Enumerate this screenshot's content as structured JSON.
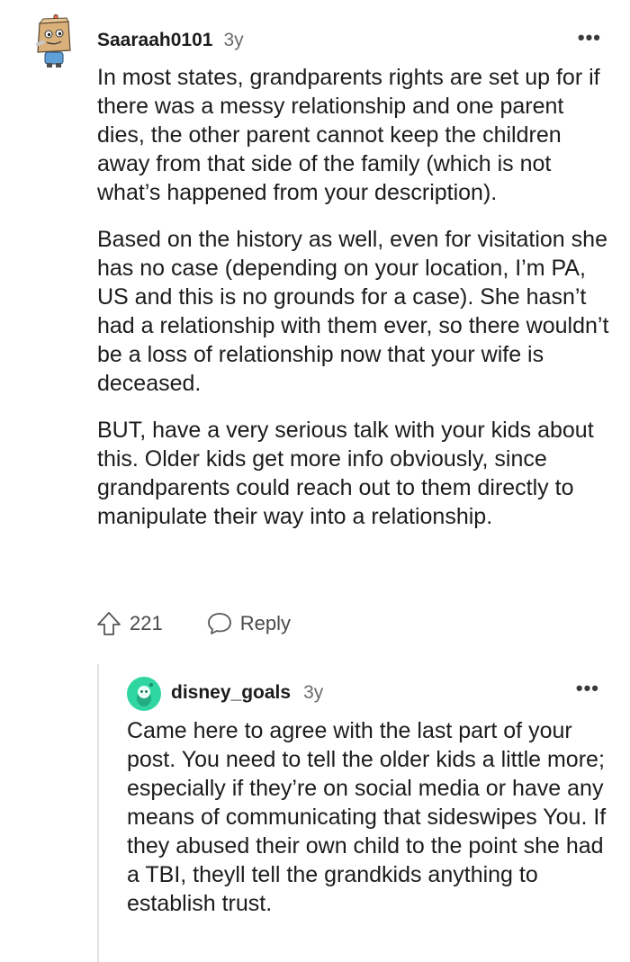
{
  "comment": {
    "username": "Saaraah0101",
    "age": "3y",
    "more": "•••",
    "paragraphs": [
      "In most states, grandparents rights are set up for if there was a messy relationship and one parent dies, the other parent cannot keep the children away from that side of the family (which is not what’s happened from your description).",
      "Based on the history as well, even for visitation she has no case (depending on your location, I’m PA, US and this is no grounds for a case). She hasn’t had a relationship with them ever, so there wouldn’t be a loss of relationship now that your wife is deceased.",
      "BUT, have a very serious talk with your kids about this. Older kids get more info obviously, since grandparents could reach out to them directly to manipulate their way into a relationship."
    ],
    "vote_count": "221",
    "reply_label": "Reply"
  },
  "reply": {
    "username": "disney_goals",
    "age": "3y",
    "more": "•••",
    "text": "Came here to agree with the last part of your post. You need to tell the older kids a little more; especially if they’re on social media or have any means of communicating that sideswipes You. If they abused their own child to the point she had a TBI, theyll tell the grandkids anything to establish trust."
  },
  "colors": {
    "text": "#1c1c1c",
    "meta": "#6b6b6b",
    "reply_avatar": "#2fd6a0",
    "thread_line": "#e3e3e3"
  },
  "icons": {
    "upvote": "upvote-arrow-icon",
    "reply": "speech-bubble-icon",
    "more": "more-options-icon"
  }
}
